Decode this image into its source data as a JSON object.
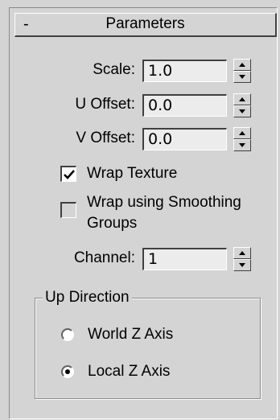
{
  "rollout": {
    "collapse_glyph": "-",
    "title": "Parameters"
  },
  "fields": {
    "scale": {
      "label": "Scale:",
      "value": "1.0"
    },
    "u_offset": {
      "label": "U Offset:",
      "value": "0.0"
    },
    "v_offset": {
      "label": "V Offset:",
      "value": "0.0"
    },
    "channel": {
      "label": "Channel:",
      "value": "1"
    }
  },
  "checkboxes": {
    "wrap_texture": {
      "label": "Wrap Texture",
      "checked": true
    },
    "wrap_smoothing": {
      "label_line1": "Wrap using Smoothing",
      "label_line2": "Groups",
      "checked": false
    }
  },
  "up_direction": {
    "title": "Up Direction",
    "options": [
      {
        "label": "World Z Axis",
        "selected": false
      },
      {
        "label": "Local Z Axis",
        "selected": true
      }
    ]
  },
  "icons": {
    "spinner": "spinner-arrows-icon",
    "check": "checkmark-icon"
  }
}
